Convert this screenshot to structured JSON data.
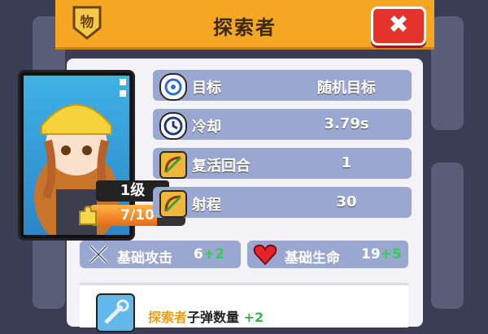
{
  "header": {
    "title": "探索者",
    "badge_char": "物",
    "close_glyph": "✖"
  },
  "character": {
    "level": "1级",
    "xp": "7/10",
    "xp_fraction": 0.7
  },
  "stats": [
    {
      "label": "目标",
      "value": "随机目标",
      "icon": "crosshair-icon"
    },
    {
      "label": "冷却",
      "value": "3.79s",
      "icon": "clock-icon"
    },
    {
      "label": "复活回合",
      "value": "1",
      "icon": "bow-icon"
    },
    {
      "label": "射程",
      "value": "30",
      "icon": "bow-icon"
    }
  ],
  "base_stats": {
    "attack": {
      "label": "基础攻击",
      "value": "6",
      "bonus": "+2"
    },
    "hp": {
      "label": "基础生命",
      "value": "19",
      "bonus": "+5"
    }
  },
  "skill": {
    "name": "探索者",
    "text": "子弹数量",
    "bonus": "+2"
  }
}
